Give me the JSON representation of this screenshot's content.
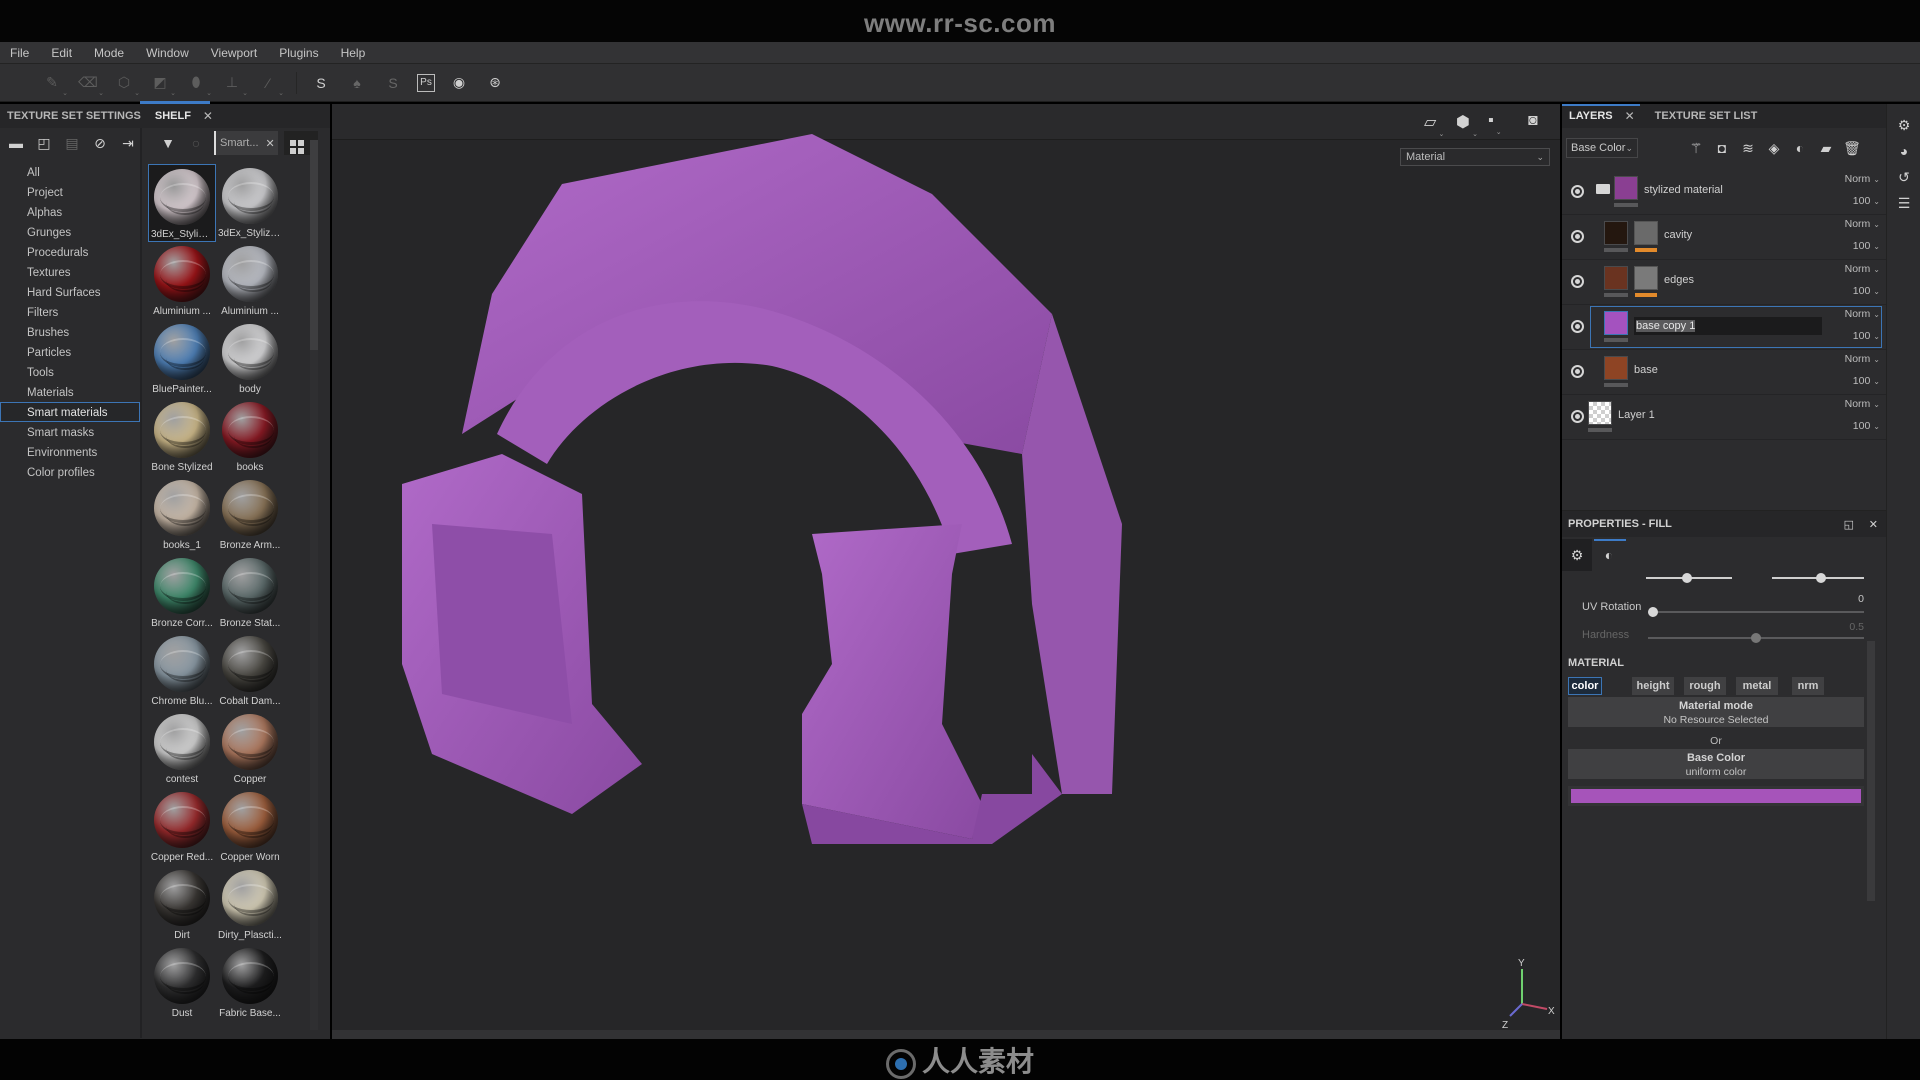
{
  "watermarks": {
    "top": "www.rr-sc.com",
    "bottom": "人人素材"
  },
  "menu": [
    "File",
    "Edit",
    "Mode",
    "Window",
    "Viewport",
    "Plugins",
    "Help"
  ],
  "toolbar": {
    "tools": [
      {
        "name": "paint-brush-icon",
        "glyph": "✎"
      },
      {
        "name": "eraser-icon",
        "glyph": "⌫"
      },
      {
        "name": "projection-icon",
        "glyph": "⬡"
      },
      {
        "name": "polygon-fill-icon",
        "glyph": "◩"
      },
      {
        "name": "smudge-icon",
        "glyph": "⬮"
      },
      {
        "name": "clone-stamp-icon",
        "glyph": "⊥"
      },
      {
        "name": "color-picker-icon",
        "glyph": "⁄"
      }
    ],
    "actions": [
      {
        "name": "substance-share-icon",
        "glyph": "S"
      },
      {
        "name": "bell-icon",
        "glyph": "♠"
      },
      {
        "name": "substance-source-icon",
        "glyph": "S"
      },
      {
        "name": "photoshop-export-icon",
        "glyph": "Ps"
      },
      {
        "name": "iray-render-icon",
        "glyph": "◉"
      },
      {
        "name": "settings-sync-icon",
        "glyph": "⊛"
      }
    ]
  },
  "left_panel": {
    "tabs": [
      {
        "label": "TEXTURE SET SETTINGS",
        "active": false
      },
      {
        "label": "SHELF",
        "active": true,
        "closable": true
      }
    ],
    "filter_tag": "Smart...",
    "categories": [
      "All",
      "Project",
      "Alphas",
      "Grunges",
      "Procedurals",
      "Textures",
      "Hard Surfaces",
      "Filters",
      "Brushes",
      "Particles",
      "Tools",
      "Materials",
      "Smart materials",
      "Smart masks",
      "Environments",
      "Color profiles"
    ],
    "selected_category": "Smart materials",
    "materials": [
      {
        "label": "3dEx_Stylize...",
        "color": "#d9cdd2",
        "selected": true
      },
      {
        "label": "3dEx_Stylize...",
        "color": "#cfcfd2"
      },
      {
        "label": "Aluminium ...",
        "color": "#9c1418"
      },
      {
        "label": "Aluminium ...",
        "color": "#b9bcc4"
      },
      {
        "label": "BluePainter...",
        "color": "#4f81b8"
      },
      {
        "label": "body",
        "color": "#d6d6d8"
      },
      {
        "label": "Bone Stylized",
        "color": "#cdb98a"
      },
      {
        "label": "books",
        "color": "#8a1a24"
      },
      {
        "label": "books_1",
        "color": "#c9b9a8"
      },
      {
        "label": "Bronze Arm...",
        "color": "#8a7458"
      },
      {
        "label": "Bronze Corr...",
        "color": "#3f8a6c"
      },
      {
        "label": "Bronze Stat...",
        "color": "#5d6c6c"
      },
      {
        "label": "Chrome Blu...",
        "color": "#8a99a4"
      },
      {
        "label": "Cobalt Dam...",
        "color": "#4c4a44"
      },
      {
        "label": "contest",
        "color": "#d2d2d2"
      },
      {
        "label": "Copper",
        "color": "#b07a60"
      },
      {
        "label": "Copper Red...",
        "color": "#9a2a2c"
      },
      {
        "label": "Copper Worn",
        "color": "#a0603e"
      },
      {
        "label": "Dirt",
        "color": "#3a3734"
      },
      {
        "label": "Dirty_Plascti...",
        "color": "#d4cdb6"
      },
      {
        "label": "Dust",
        "color": "#2f2f30"
      },
      {
        "label": "Fabric Base...",
        "color": "#1e1e1f"
      }
    ]
  },
  "viewport": {
    "display_mode": "Material",
    "icons": [
      "perspective-frame-icon",
      "cube-icon",
      "camera-icon",
      "screenshot-icon"
    ],
    "model_color": "#a45cbc",
    "axis": {
      "x": "X",
      "y": "Y",
      "z": "Z"
    }
  },
  "right_panel": {
    "tabs": [
      {
        "label": "LAYERS",
        "active": true,
        "closable": true
      },
      {
        "label": "TEXTURE SET LIST",
        "active": false
      }
    ],
    "channel": "Base Color",
    "layer_actions": [
      "magic-wand-icon",
      "refresh-effect-icon",
      "add-layer-icon",
      "add-fill-icon",
      "add-mask-icon",
      "add-folder-icon",
      "trash-icon"
    ],
    "layers": [
      {
        "name": "stylized material",
        "blend": "Norm",
        "opacity": "100",
        "folder": true,
        "thumb": "#8a3f92",
        "indent": 0
      },
      {
        "name": "cavity",
        "blend": "Norm",
        "opacity": "100",
        "thumb": "#24170f",
        "mask": "#6a6a6a",
        "indent": 1
      },
      {
        "name": "edges",
        "blend": "Norm",
        "opacity": "100",
        "thumb": "#6a3320",
        "mask": "#7a7a7a",
        "indent": 1
      },
      {
        "name": "base copy 1",
        "blend": "Norm",
        "opacity": "100",
        "thumb": "#a452bf",
        "indent": 1,
        "selected": true,
        "editing": true
      },
      {
        "name": "base",
        "blend": "Norm",
        "opacity": "100",
        "thumb": "#8e4424",
        "indent": 1
      },
      {
        "name": "Layer 1",
        "blend": "Norm",
        "opacity": "100",
        "checker": true,
        "indent": 0
      }
    ],
    "properties": {
      "title": "PROPERTIES - FILL",
      "uv_rotation": {
        "label": "UV Rotation",
        "value": "0",
        "fraction": 0.0
      },
      "hardness": {
        "label": "Hardness",
        "value": "0.5",
        "fraction": 0.5
      },
      "material_title": "MATERIAL",
      "channels": [
        {
          "label": "color",
          "active": true
        },
        {
          "label": "height",
          "active": false
        },
        {
          "label": "rough",
          "active": false
        },
        {
          "label": "metal",
          "active": false
        },
        {
          "label": "nrm",
          "active": false
        }
      ],
      "material_mode": {
        "title": "Material mode",
        "subtitle": "No Resource Selected"
      },
      "or_label": "Or",
      "base_color": {
        "title": "Base Color",
        "subtitle": "uniform color",
        "value": "#a654ba"
      }
    },
    "side_icons": [
      "display-settings-icon",
      "shader-settings-icon",
      "history-icon",
      "log-icon"
    ]
  }
}
